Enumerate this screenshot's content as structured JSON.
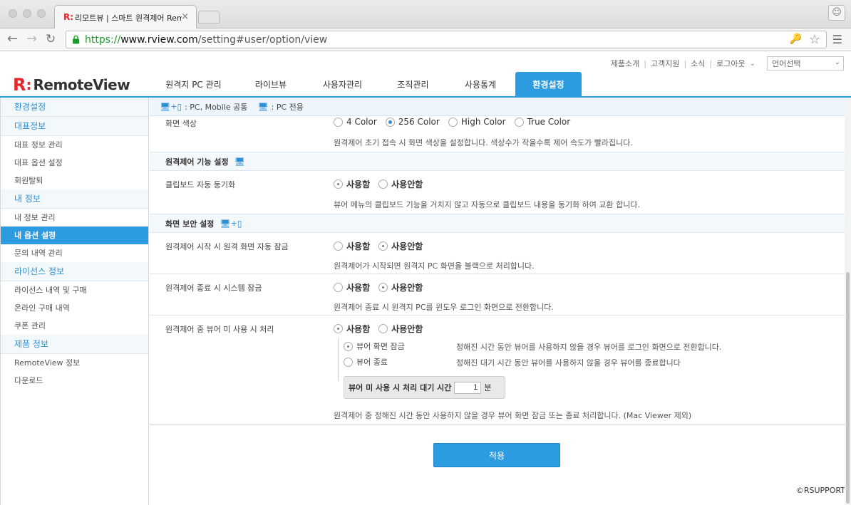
{
  "browser": {
    "tab_logo": "R:",
    "tab_title": "리모트뷰 | 스마트 원격제어 Rem",
    "tab_close": "×",
    "url_scheme": "https://",
    "url_host": "www.rview.com",
    "url_path": "/setting#user/option/view"
  },
  "topnav": {
    "links": [
      "제품소개",
      "고객지원",
      "소식",
      "로그아웃"
    ],
    "separator": "|",
    "language_select": "언어선택"
  },
  "logo": {
    "mark": "R",
    "colon": ":",
    "text": "RemoteView"
  },
  "gnb": {
    "items": [
      "원격지 PC 관리",
      "라이브뷰",
      "사용자관리",
      "조직관리",
      "사용통계",
      "환경설정"
    ],
    "active_index": 5
  },
  "sidebar": {
    "sections": [
      {
        "label": "환경설정",
        "items": []
      },
      {
        "label": "대표정보",
        "items": [
          "대표 정보 관리",
          "대표 옵션 설정",
          "회원탈퇴"
        ]
      },
      {
        "label": "내 정보",
        "items": [
          "내 정보 관리",
          "내 옵션 설정",
          "문의 내역 관리"
        ]
      },
      {
        "label": "라이선스 정보",
        "items": [
          "라이선스 내역 및 구매",
          "온라인 구매 내역",
          "쿠폰 관리"
        ]
      },
      {
        "label": "제품 정보",
        "items": [
          "RemoteView 정보",
          "다운로드"
        ]
      }
    ],
    "active_item": "내 옵션 설정"
  },
  "legend": {
    "plus": "+",
    "both": ": PC, Mobile 공통",
    "pc_only": ": PC 전용"
  },
  "screen_color": {
    "label": "화면 색상",
    "options": [
      "4 Color",
      "256 Color",
      "High Color",
      "True Color"
    ],
    "selected": "256 Color",
    "description": "원격제어 초기 접속 시 화면 색상을 설정합니다. 색상수가 작을수록 제어 속도가 빨라집니다."
  },
  "remote_feature": {
    "heading": "원격제어 기능 설정",
    "clipboard": {
      "label": "클립보드 자동 동기화",
      "options": [
        "사용함",
        "사용안함"
      ],
      "description": "뷰어 메뉴의 클립보드 기능을 거치지 않고 자동으로 클립보드 내용을 동기화 하여 교환 합니다."
    }
  },
  "screen_security": {
    "heading": "화면 보안 설정",
    "auto_lock": {
      "label": "원격제어 시작 시 원격 화면 자동 잠금",
      "options": [
        "사용함",
        "사용안함"
      ],
      "description": "원격제어가 시작되면 원격지 PC 화면을 블랙으로 처리합니다."
    },
    "system_lock": {
      "label": "원격제어 종료 시 시스템 잠금",
      "options": [
        "사용함",
        "사용안함"
      ],
      "description": "원격제어 종료 시 원격지 PC를 윈도우 로그인 화면으로 전환합니다."
    },
    "idle": {
      "label": "원격제어 중 뷰어 미 사용 시 처리",
      "options": [
        "사용함",
        "사용안함"
      ],
      "sub_options": [
        {
          "label": "뷰어 화면 잠금",
          "description": "정해진 시간 동안 뷰어를 사용하지 않을 경우 뷰어를 로그인 화면으로 전환합니다."
        },
        {
          "label": "뷰어 종료",
          "description": "정해진 대기 시간 동안 뷰어를 사용하지 않을 경우 뷰어를 종료합니다"
        }
      ],
      "wait_label": "뷰어 미 사용 시 처리 대기 시간",
      "wait_value": "1",
      "wait_unit": "분",
      "description": "원격제어 중 정해진 시간 동안 사용하지 않을 경우 뷰어 화면 잠금 또는 종료 처리합니다. (Mac Viewer 제외)"
    }
  },
  "apply_button": "적용",
  "copyright": "©RSUPPORT",
  "colors": {
    "accent": "#2d9be0",
    "brand_red": "#e5252a"
  },
  "icons": [
    "monitor-icon",
    "mobile-icon",
    "lock-icon",
    "star-icon",
    "key-icon"
  ]
}
